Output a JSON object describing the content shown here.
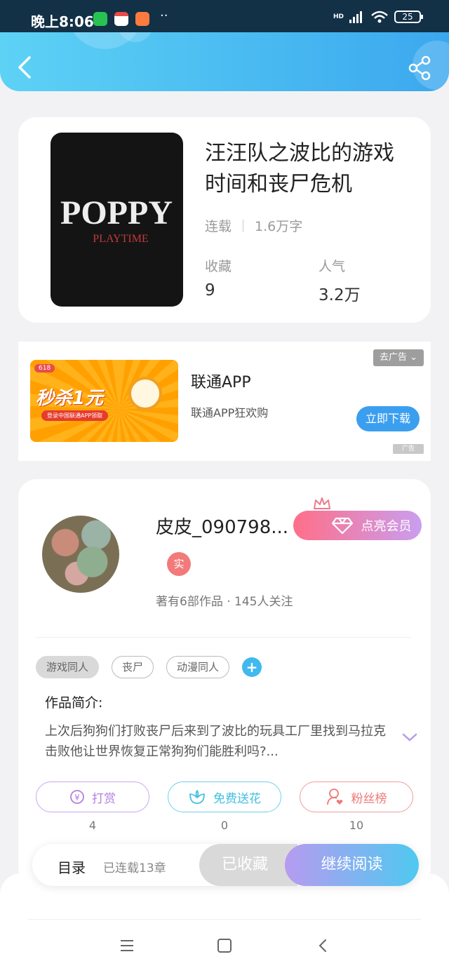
{
  "status_bar": {
    "time": "晚上8:06",
    "dots": "··",
    "battery": "25",
    "network": "HD"
  },
  "colors": {
    "header_gradient_start": "#5dd2f5",
    "header_gradient_end": "#3ba8ee",
    "accent_blue": "#40b9ee",
    "vip_pink": "#ff6f88",
    "reward_purple": "#b27fe0",
    "flower_cyan": "#40c0e0",
    "fans_red": "#ee7878"
  },
  "book": {
    "title": "汪汪队之波比的游戏时间和丧尸危机",
    "cover_text_main": "POPPY",
    "cover_text_sub": "PLAYTIME",
    "status": "连载",
    "word_count": "1.6万字",
    "favorites_label": "收藏",
    "favorites_value": "9",
    "popularity_label": "人气",
    "popularity_value": "3.2万"
  },
  "ad": {
    "banner_badge": "618",
    "banner_text": "秒杀1元",
    "banner_sub": "登录中国联通APP领取",
    "title": "联通APP",
    "subtitle": "联通APP狂欢购",
    "remove_label": "去广告",
    "download_label": "立即下载",
    "ad_tag": "广告"
  },
  "author": {
    "name": "皮皮_090798...",
    "vip_label": "点亮会员",
    "real_badge": "实",
    "stats": "著有6部作品 · 145人关注"
  },
  "tags": [
    "游戏同人",
    "丧尸",
    "动漫同人"
  ],
  "intro": {
    "label": "作品简介:",
    "text": "上次后狗狗们打败丧尸后来到了波比的玩具工厂里找到马拉克击败他让世界恢复正常狗狗们能胜利吗?..."
  },
  "actions": {
    "reward_label": "打赏",
    "reward_count": "4",
    "flower_label": "免费送花",
    "flower_count": "0",
    "fans_label": "粉丝榜",
    "fans_count": "10"
  },
  "bottom_bar": {
    "toc_label": "目录",
    "chapters_label": "已连载13章",
    "fav_label": "已收藏",
    "read_label": "继续阅读"
  },
  "icons": [
    "back-icon",
    "share-icon",
    "crown-icon",
    "diamond-icon",
    "yuan-icon",
    "flower-icon",
    "fans-icon",
    "chevron-down-icon",
    "plus-icon",
    "menu-icon",
    "home-icon",
    "nav-back-icon"
  ]
}
